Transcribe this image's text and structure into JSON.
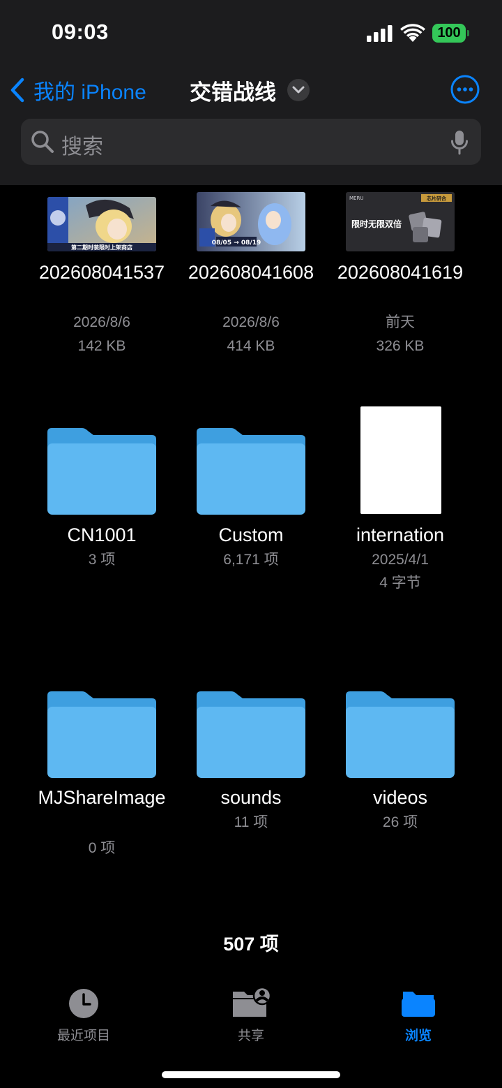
{
  "status_bar": {
    "time": "09:03",
    "battery": "100"
  },
  "nav": {
    "back_label": "我的 iPhone",
    "title": "交错战线"
  },
  "search": {
    "placeholder": "搜索"
  },
  "items": [
    {
      "name": "202608041537",
      "line1": "2026/8/6",
      "line2": "142 KB",
      "kind": "image"
    },
    {
      "name": "202608041608",
      "line1": "2026/8/6",
      "line2": "414 KB",
      "kind": "image"
    },
    {
      "name": "202608041619",
      "line1": "前天",
      "line2": "326 KB",
      "kind": "image"
    },
    {
      "name": "CN1001",
      "line1": "3 项",
      "kind": "folder"
    },
    {
      "name": "Custom",
      "line1": "6,171 项",
      "kind": "folder"
    },
    {
      "name": "internation",
      "line1": "2025/4/1",
      "line2": "4 字节",
      "kind": "document"
    },
    {
      "name": "MJShareImage",
      "line1": "0 项",
      "kind": "folder"
    },
    {
      "name": "sounds",
      "line1": "11 项",
      "kind": "folder"
    },
    {
      "name": "videos",
      "line1": "26 项",
      "kind": "folder"
    }
  ],
  "thumbs": {
    "t1_caption": "第二期时装限时上架商店",
    "t2_dates": "08/05 → 08/19",
    "t3_brand": "MERU",
    "t3_tag": "芯片研合",
    "t3_headline": "限时无限双倍"
  },
  "footer": {
    "count": "507 项"
  },
  "tabs": [
    {
      "label": "最近项目",
      "icon": "clock-icon"
    },
    {
      "label": "共享",
      "icon": "shared-folder-icon"
    },
    {
      "label": "浏览",
      "icon": "folder-icon"
    }
  ],
  "colors": {
    "accent": "#0a84ff",
    "folder": "#5eb8f2",
    "battery": "#34c759"
  }
}
